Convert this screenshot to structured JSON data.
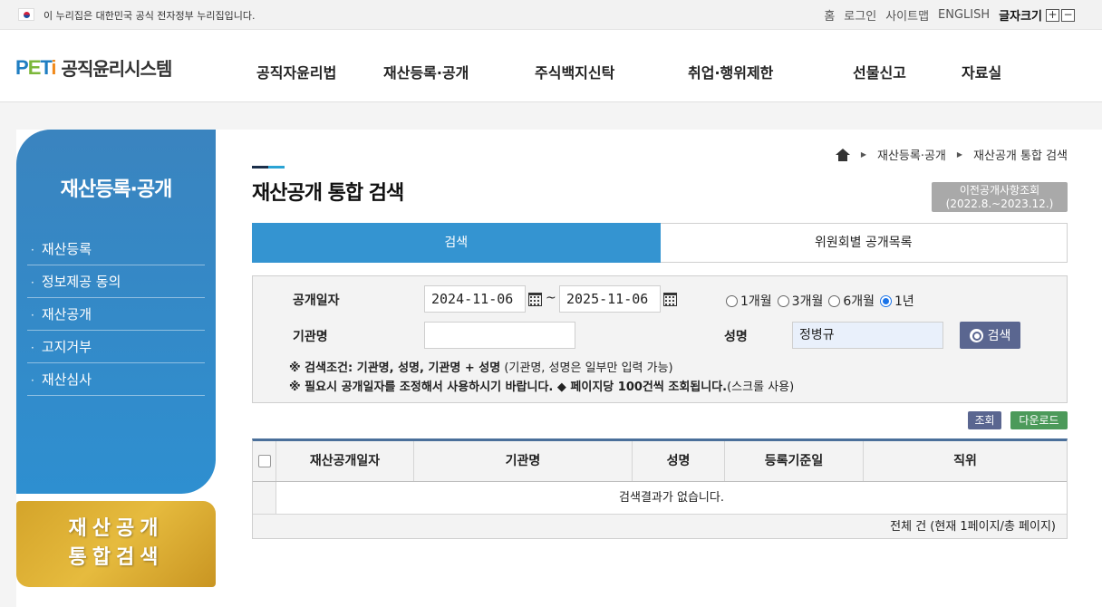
{
  "topbar": {
    "notice": "이 누리집은 대한민국 공식 전자정부 누리집입니다.",
    "links": [
      "홈",
      "로그인",
      "사이트맵",
      "ENGLISH"
    ],
    "font_size_label": "글자크기",
    "font_plus": "+",
    "font_minus": "−"
  },
  "header": {
    "logo_p": "P",
    "logo_e": "E",
    "logo_t": "T",
    "logo_i": "i",
    "logo_name": "공직윤리시스템",
    "nav": [
      "공직자윤리법",
      "재산등록·공개",
      "주식백지신탁",
      "취업·행위제한",
      "선물신고",
      "자료실"
    ]
  },
  "sidebar": {
    "title": "재산등록·공개",
    "items": [
      {
        "label": "재산등록"
      },
      {
        "label": "정보제공 동의"
      },
      {
        "label": "재산공개"
      },
      {
        "label": "고지거부"
      },
      {
        "label": "재산심사"
      }
    ],
    "banner_line1": "재산공개",
    "banner_line2": "통합검색"
  },
  "breadcrumb": {
    "items": [
      "재산등록·공개",
      "재산공개 통합 검색"
    ]
  },
  "page": {
    "title": "재산공개 통합 검색",
    "prev_button_line1": "이전공개사항조회",
    "prev_button_line2": "(2022.8.~2023.12.)"
  },
  "tabs": [
    {
      "label": "검색",
      "active": true
    },
    {
      "label": "위원회별 공개목록",
      "active": false
    }
  ],
  "search": {
    "date_label": "공개일자",
    "date_from": "2024-11-06",
    "date_to": "2025-11-06",
    "tilde": "~",
    "periods": [
      {
        "label": "1개월",
        "selected": false
      },
      {
        "label": "3개월",
        "selected": false
      },
      {
        "label": "6개월",
        "selected": false
      },
      {
        "label": "1년",
        "selected": true
      }
    ],
    "org_label": "기관명",
    "org_value": "",
    "name_label": "성명",
    "name_value": "정병규",
    "search_button": "검색",
    "note1_bold": "※ 검색조건: 기관명, 성명, 기관명 + 성명",
    "note1_rest": "(기관명, 성명은 일부만 입력 가능)",
    "note2_bold": "※ 필요시 공개일자를 조정해서 사용하시기 바랍니다. ◆ 페이지당 100건씩 조회됩니다.",
    "note2_rest": "(스크롤 사용)"
  },
  "actions": {
    "view": "조회",
    "download": "다운로드"
  },
  "table": {
    "headers": [
      "재산공개일자",
      "기관명",
      "성명",
      "등록기준일",
      "직위"
    ],
    "empty_message": "검색결과가 없습니다.",
    "footer": "전체 건 (현재 1페이지/총 페이지)"
  },
  "colors": {
    "primary": "#3494d1",
    "sidebar": "#2e8fd0",
    "banner": "#d4a42a",
    "search_button": "#5a6690",
    "download_button": "#4c9a5a",
    "view_button": "#5a6690"
  }
}
